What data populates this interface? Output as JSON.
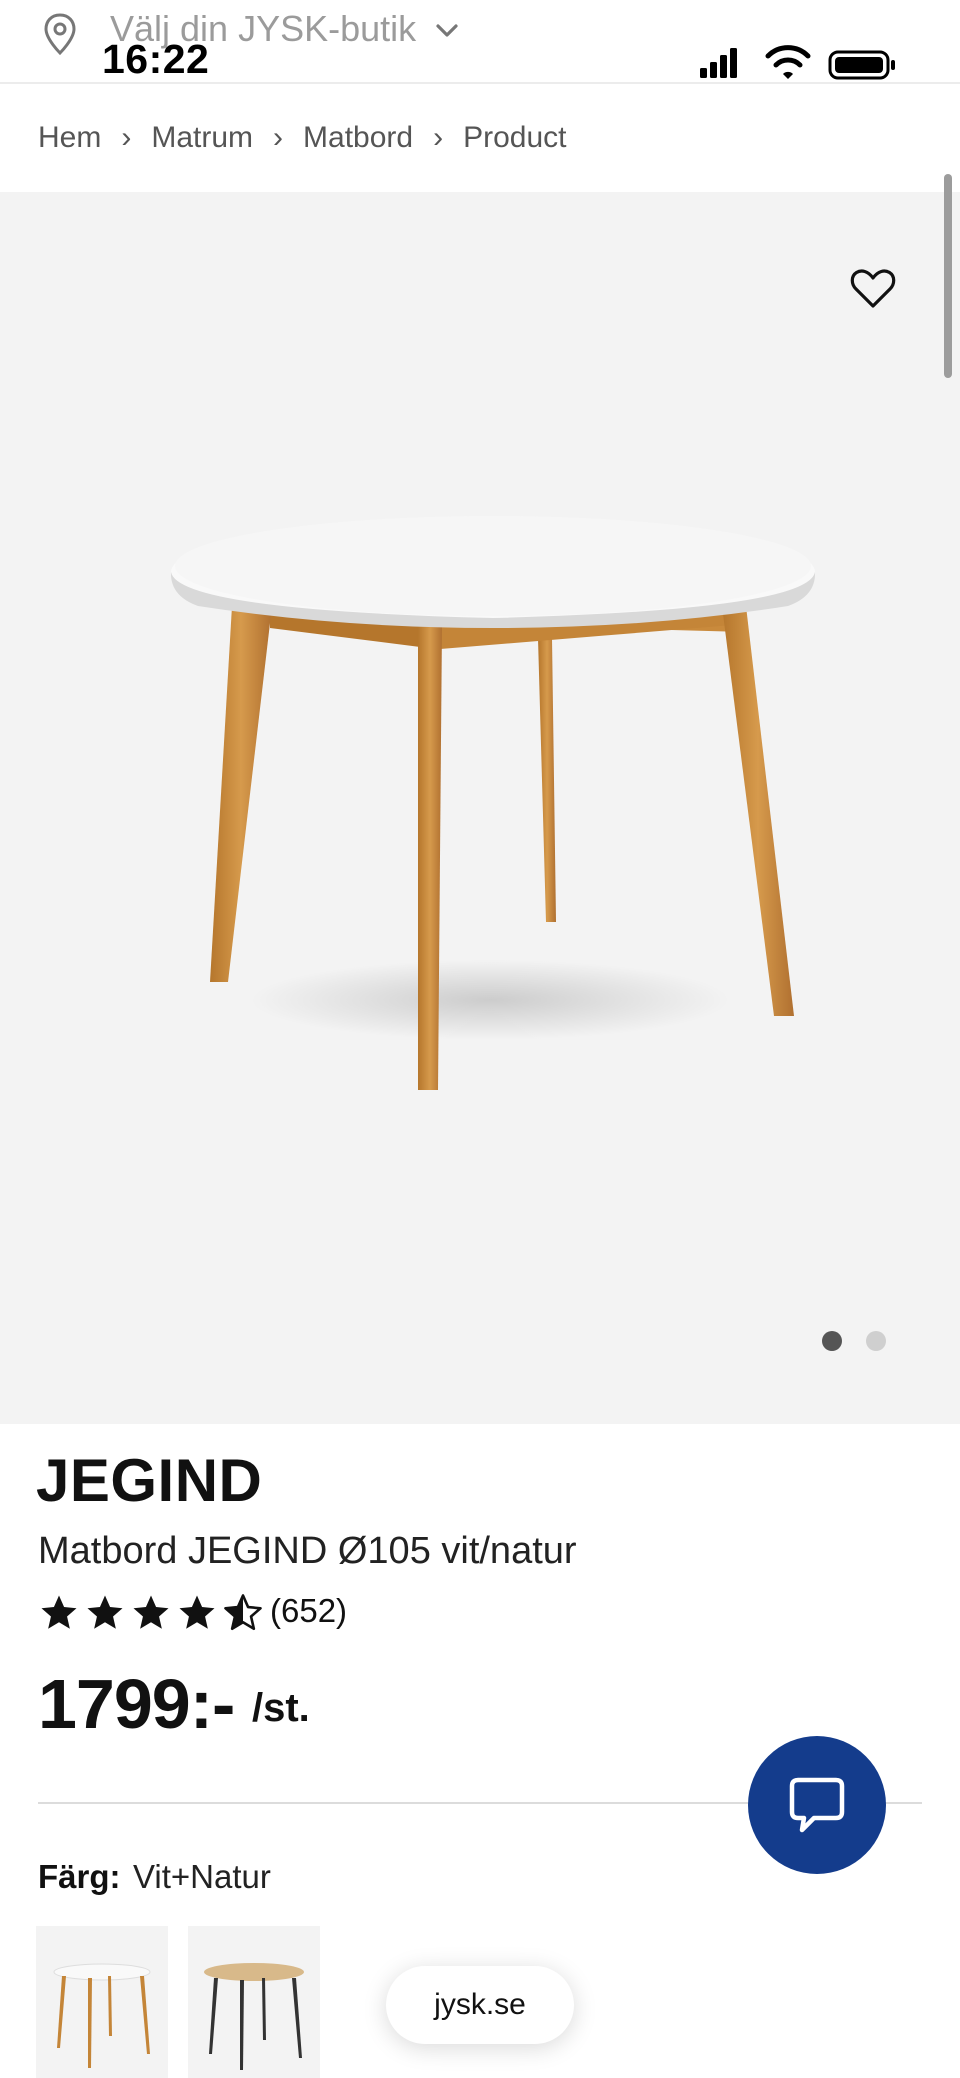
{
  "status_bar": {
    "time": "16:22"
  },
  "store_selector": {
    "label": "Välj din JYSK-butik",
    "icon": "location-pin-icon",
    "chevron": "chevron-down-icon"
  },
  "breadcrumb": [
    {
      "label": "Hem"
    },
    {
      "label": "Matrum"
    },
    {
      "label": "Matbord"
    },
    {
      "label": "Product"
    }
  ],
  "gallery": {
    "image_count": 2,
    "active_index": 0,
    "favorite_icon": "heart-icon"
  },
  "product": {
    "brand": "JEGIND",
    "name": "Matbord JEGIND Ø105 vit/natur",
    "rating": 4.5,
    "rating_max": 5,
    "review_count": "(652)",
    "price": "1799:-",
    "unit": "/st.",
    "color_label": "Färg:",
    "color_value": "Vit+Natur"
  },
  "chat": {
    "icon": "chat-bubble-icon"
  },
  "url_pill": {
    "label": "jysk.se"
  },
  "colors": {
    "accent": "#143c8c",
    "background_gallery": "#f3f3f3"
  }
}
